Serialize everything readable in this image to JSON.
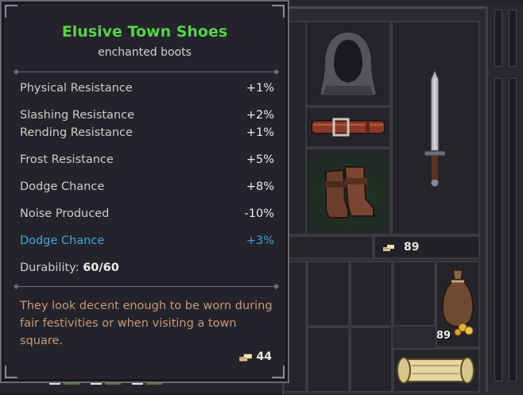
{
  "tooltip": {
    "title": "Elusive Town Shoes",
    "subtitle": "enchanted boots",
    "stats": [
      {
        "name": "Physical Resistance",
        "value": "+1%"
      },
      {
        "name": "Slashing Resistance",
        "value": "+2%"
      },
      {
        "name": "Rending Resistance",
        "value": "+1%"
      },
      {
        "name": "Frost Resistance",
        "value": "+5%"
      },
      {
        "name": "Dodge Chance",
        "value": "+8%"
      },
      {
        "name": "Noise Produced",
        "value": "-10%"
      }
    ],
    "bonus_stat": {
      "name": "Dodge Chance",
      "value": "+3%"
    },
    "durability_label": "Durability:",
    "durability_value": "60/60",
    "description": "They look decent enough to be worn during fair festivities or when visiting a town square.",
    "price": "44",
    "colors": {
      "title": "#55d24a",
      "bonus": "#3fa7e0",
      "description": "#c69a78"
    }
  },
  "inventory": {
    "gold_amount": "89",
    "bag_count": "89",
    "items": [
      "hood-icon",
      "belt-icon",
      "boots-icon",
      "sword-icon",
      "coin-bag-icon",
      "scroll-icon"
    ]
  }
}
